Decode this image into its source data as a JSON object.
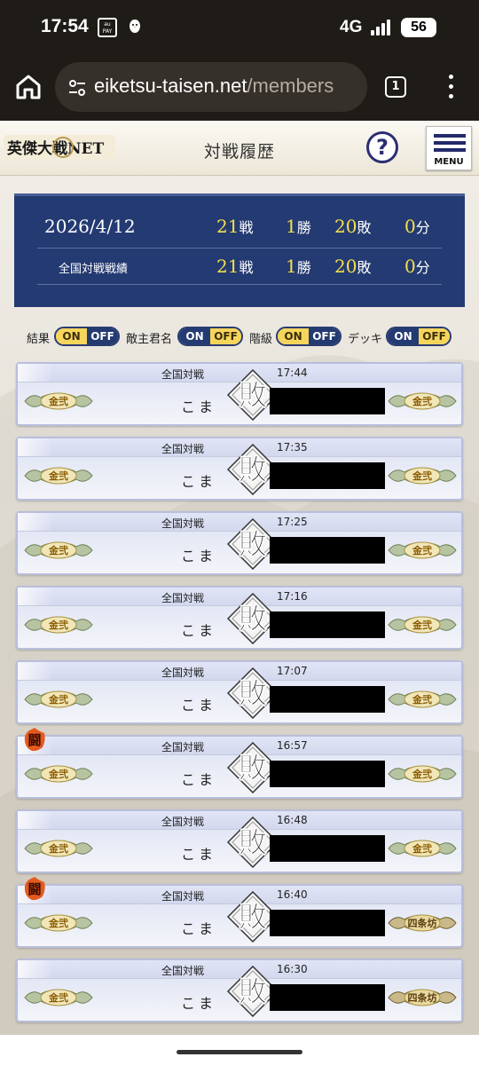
{
  "status_bar": {
    "time": "17:54",
    "network": "4G",
    "battery": "56",
    "pay_icon_text": "au PAY"
  },
  "browser": {
    "url_domain": "eiketsu-taisen.net",
    "url_path": "/members",
    "tab_count": "1"
  },
  "header": {
    "logo_text": "英傑大戦NET",
    "title": "対戦履歴",
    "help_label": "?",
    "menu_label": "MENU"
  },
  "summary": {
    "date": "2026/4/12",
    "today": {
      "battles": "21",
      "battles_unit": "戦",
      "wins": "1",
      "wins_unit": "勝",
      "losses": "20",
      "losses_unit": "敗",
      "draws": "0",
      "draws_unit": "分"
    },
    "national_label": "全国対戦戦績",
    "national": {
      "battles": "21",
      "battles_unit": "戦",
      "wins": "1",
      "wins_unit": "勝",
      "losses": "20",
      "losses_unit": "敗",
      "draws": "0",
      "draws_unit": "分"
    }
  },
  "filters": [
    {
      "label": "結果",
      "on": "ON",
      "off": "OFF",
      "state": "on"
    },
    {
      "label": "敵主君名",
      "on": "ON",
      "off": "OFF",
      "state": "off"
    },
    {
      "label": "階級",
      "on": "ON",
      "off": "OFF",
      "state": "on"
    },
    {
      "label": "デッキ",
      "on": "ON",
      "off": "OFF",
      "state": "off"
    }
  ],
  "battles": [
    {
      "type": "全国対戦",
      "time": "17:44",
      "player": "こま",
      "result": "敗",
      "left_rank": "金弐",
      "right_rank": "金弐",
      "seal": false
    },
    {
      "type": "全国対戦",
      "time": "17:35",
      "player": "こま",
      "result": "敗",
      "left_rank": "金弐",
      "right_rank": "金弐",
      "seal": false
    },
    {
      "type": "全国対戦",
      "time": "17:25",
      "player": "こま",
      "result": "敗",
      "left_rank": "金弐",
      "right_rank": "金弐",
      "seal": false
    },
    {
      "type": "全国対戦",
      "time": "17:16",
      "player": "こま",
      "result": "敗",
      "left_rank": "金弐",
      "right_rank": "金弐",
      "seal": false
    },
    {
      "type": "全国対戦",
      "time": "17:07",
      "player": "こま",
      "result": "敗",
      "left_rank": "金弐",
      "right_rank": "金弐",
      "seal": false
    },
    {
      "type": "全国対戦",
      "time": "16:57",
      "player": "こま",
      "result": "敗",
      "left_rank": "金弐",
      "right_rank": "金弐",
      "seal": true,
      "seal_text": "闘"
    },
    {
      "type": "全国対戦",
      "time": "16:48",
      "player": "こま",
      "result": "敗",
      "left_rank": "金弐",
      "right_rank": "金弐",
      "seal": false
    },
    {
      "type": "全国対戦",
      "time": "16:40",
      "player": "こま",
      "result": "敗",
      "left_rank": "金弐",
      "right_rank": "四条坊",
      "seal": true,
      "seal_text": "闘"
    },
    {
      "type": "全国対戦",
      "time": "16:30",
      "player": "こま",
      "result": "敗",
      "left_rank": "金弐",
      "right_rank": "四条坊",
      "seal": false
    }
  ],
  "colors": {
    "navy": "#243a72",
    "gold": "#f5e04a",
    "panel": "#e3e7f5"
  }
}
